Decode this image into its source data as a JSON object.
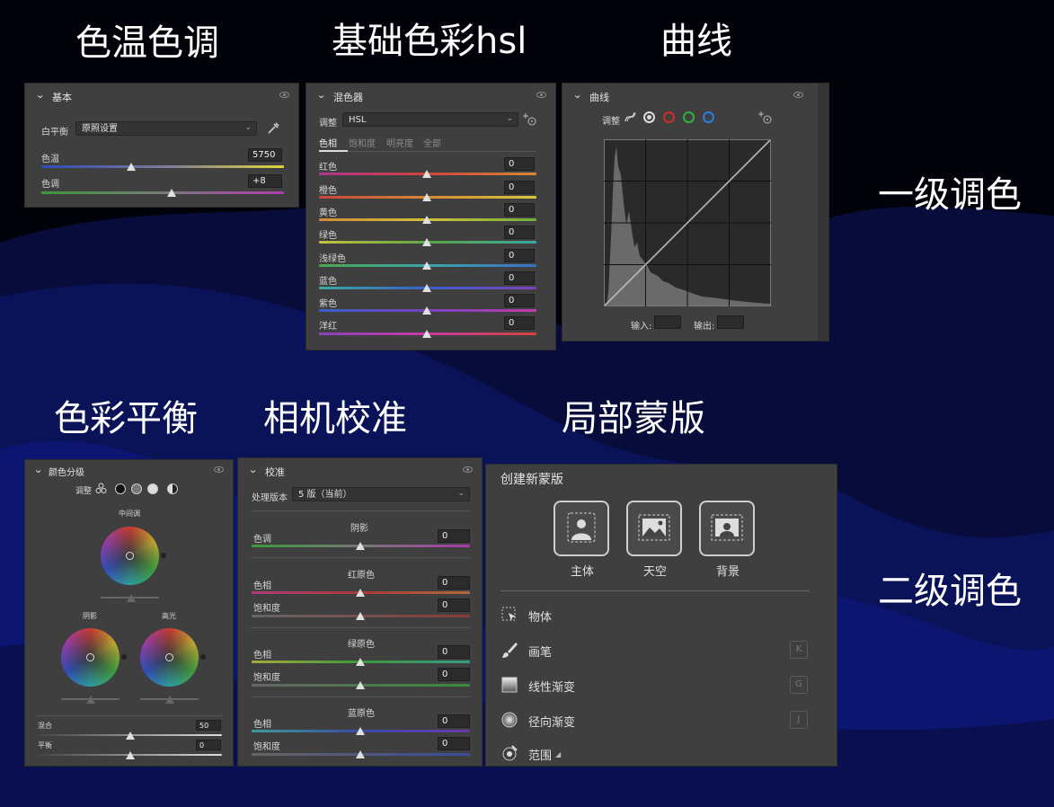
{
  "headings": {
    "wb": "色温色调",
    "hsl": "基础色彩hsl",
    "curve": "曲线",
    "level1": "一级调色",
    "balance": "色彩平衡",
    "calib": "相机校准",
    "mask": "局部蒙版",
    "level2": "二级调色"
  },
  "basic": {
    "title": "基本",
    "wb_label": "白平衡",
    "wb_value": "原照设置",
    "temp_label": "色温",
    "temp_value": "5750",
    "tint_label": "色调",
    "tint_value": "+8"
  },
  "mixer": {
    "title": "混色器",
    "adjust_label": "调整",
    "adjust_value": "HSL",
    "tabs": [
      "色相",
      "饱和度",
      "明亮度",
      "全部"
    ],
    "rows": [
      {
        "label": "红色",
        "value": "0"
      },
      {
        "label": "橙色",
        "value": "0"
      },
      {
        "label": "黄色",
        "value": "0"
      },
      {
        "label": "绿色",
        "value": "0"
      },
      {
        "label": "浅绿色",
        "value": "0"
      },
      {
        "label": "蓝色",
        "value": "0"
      },
      {
        "label": "紫色",
        "value": "0"
      },
      {
        "label": "洋红",
        "value": "0"
      }
    ]
  },
  "curves": {
    "title": "曲线",
    "adjust_label": "调整",
    "input_label": "输入:",
    "output_label": "输出:"
  },
  "grading": {
    "title": "颜色分级",
    "adjust_label": "调整",
    "midtones": "中间调",
    "shadows": "阴影",
    "highlights": "高光",
    "blend_label": "混合",
    "blend_value": "50",
    "balance_label": "平衡",
    "balance_value": "0"
  },
  "calibration": {
    "title": "校准",
    "process_label": "处理版本",
    "process_value": "5 版（当前）",
    "shadow_section": "阴影",
    "shadow_tint_label": "色调",
    "shadow_tint_value": "0",
    "red_section": "红原色",
    "red_hue_label": "色相",
    "red_hue_value": "0",
    "red_sat_label": "饱和度",
    "red_sat_value": "0",
    "green_section": "绿原色",
    "green_hue_label": "色相",
    "green_hue_value": "0",
    "green_sat_label": "饱和度",
    "green_sat_value": "0",
    "blue_section": "蓝原色",
    "blue_hue_label": "色相",
    "blue_hue_value": "0",
    "blue_sat_label": "饱和度",
    "blue_sat_value": "0"
  },
  "masking": {
    "title": "创建新蒙版",
    "btn_subject": "主体",
    "btn_sky": "天空",
    "btn_background": "背景",
    "tool_object": "物体",
    "tool_brush": "画笔",
    "tool_brush_key": "K",
    "tool_linear": "线性渐变",
    "tool_linear_key": "G",
    "tool_radial": "径向渐变",
    "tool_radial_key": "J",
    "tool_range": "范围"
  }
}
